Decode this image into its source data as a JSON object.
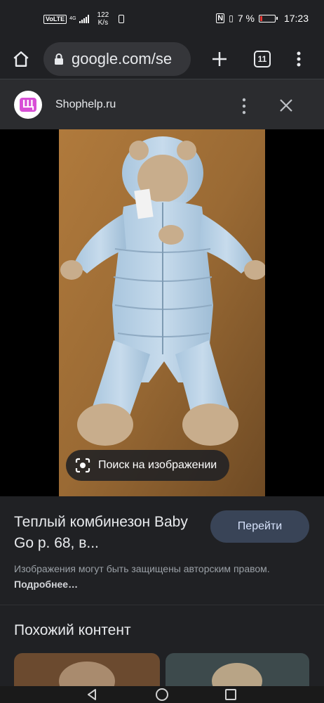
{
  "status_bar": {
    "network_badge": "VoLTE",
    "network_type": "4G",
    "speed_value": "122",
    "speed_unit": "K/s",
    "battery_percent": "7 %",
    "time": "17:23"
  },
  "browser": {
    "url": "google.com/se",
    "tab_count": "11"
  },
  "source": {
    "site_name": "Shophelp.ru",
    "logo_letter": "Щ"
  },
  "image_viewer": {
    "lens_label": "Поиск на изображении"
  },
  "result": {
    "title": "Теплый комбинезон Baby Go р. 68, в...",
    "visit_label": "Перейти",
    "copyright_text": "Изображения могут быть защищены авторским правом.",
    "more_link": "Подробнее…"
  },
  "similar": {
    "heading": "Похожий контент"
  },
  "colors": {
    "background": "#202124",
    "accent_button": "#394457",
    "logo_pink": "#d84fd6",
    "battery_low": "#e53935"
  }
}
